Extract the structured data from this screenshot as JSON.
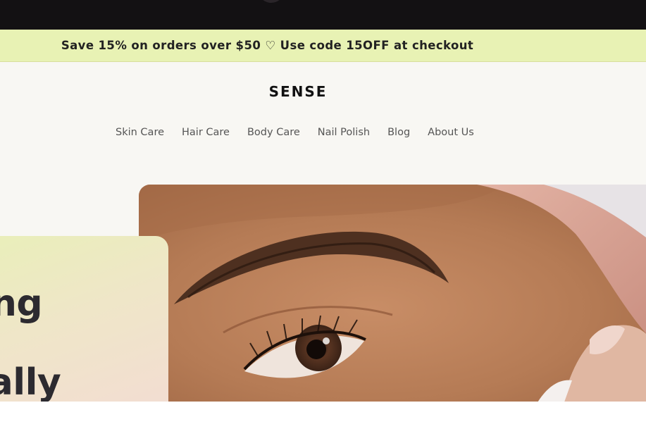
{
  "promo": {
    "text": "Save 15% on orders over $50 ♡ Use code 15OFF at checkout"
  },
  "brand": {
    "name": "SENSE"
  },
  "nav": {
    "items": [
      {
        "label": "Skin Care"
      },
      {
        "label": "Hair Care"
      },
      {
        "label": "Body Care"
      },
      {
        "label": "Nail Polish"
      },
      {
        "label": "Blog"
      },
      {
        "label": "About Us"
      }
    ]
  },
  "hero": {
    "heading": "wing\nn,\nurally",
    "image_icon": "close-up-eye-photo-icon"
  },
  "colors": {
    "topbar": "#131113",
    "promo_bg": "#e8f2b4",
    "page_bg": "#f8f7f3",
    "heading_text": "#2c2a30"
  }
}
